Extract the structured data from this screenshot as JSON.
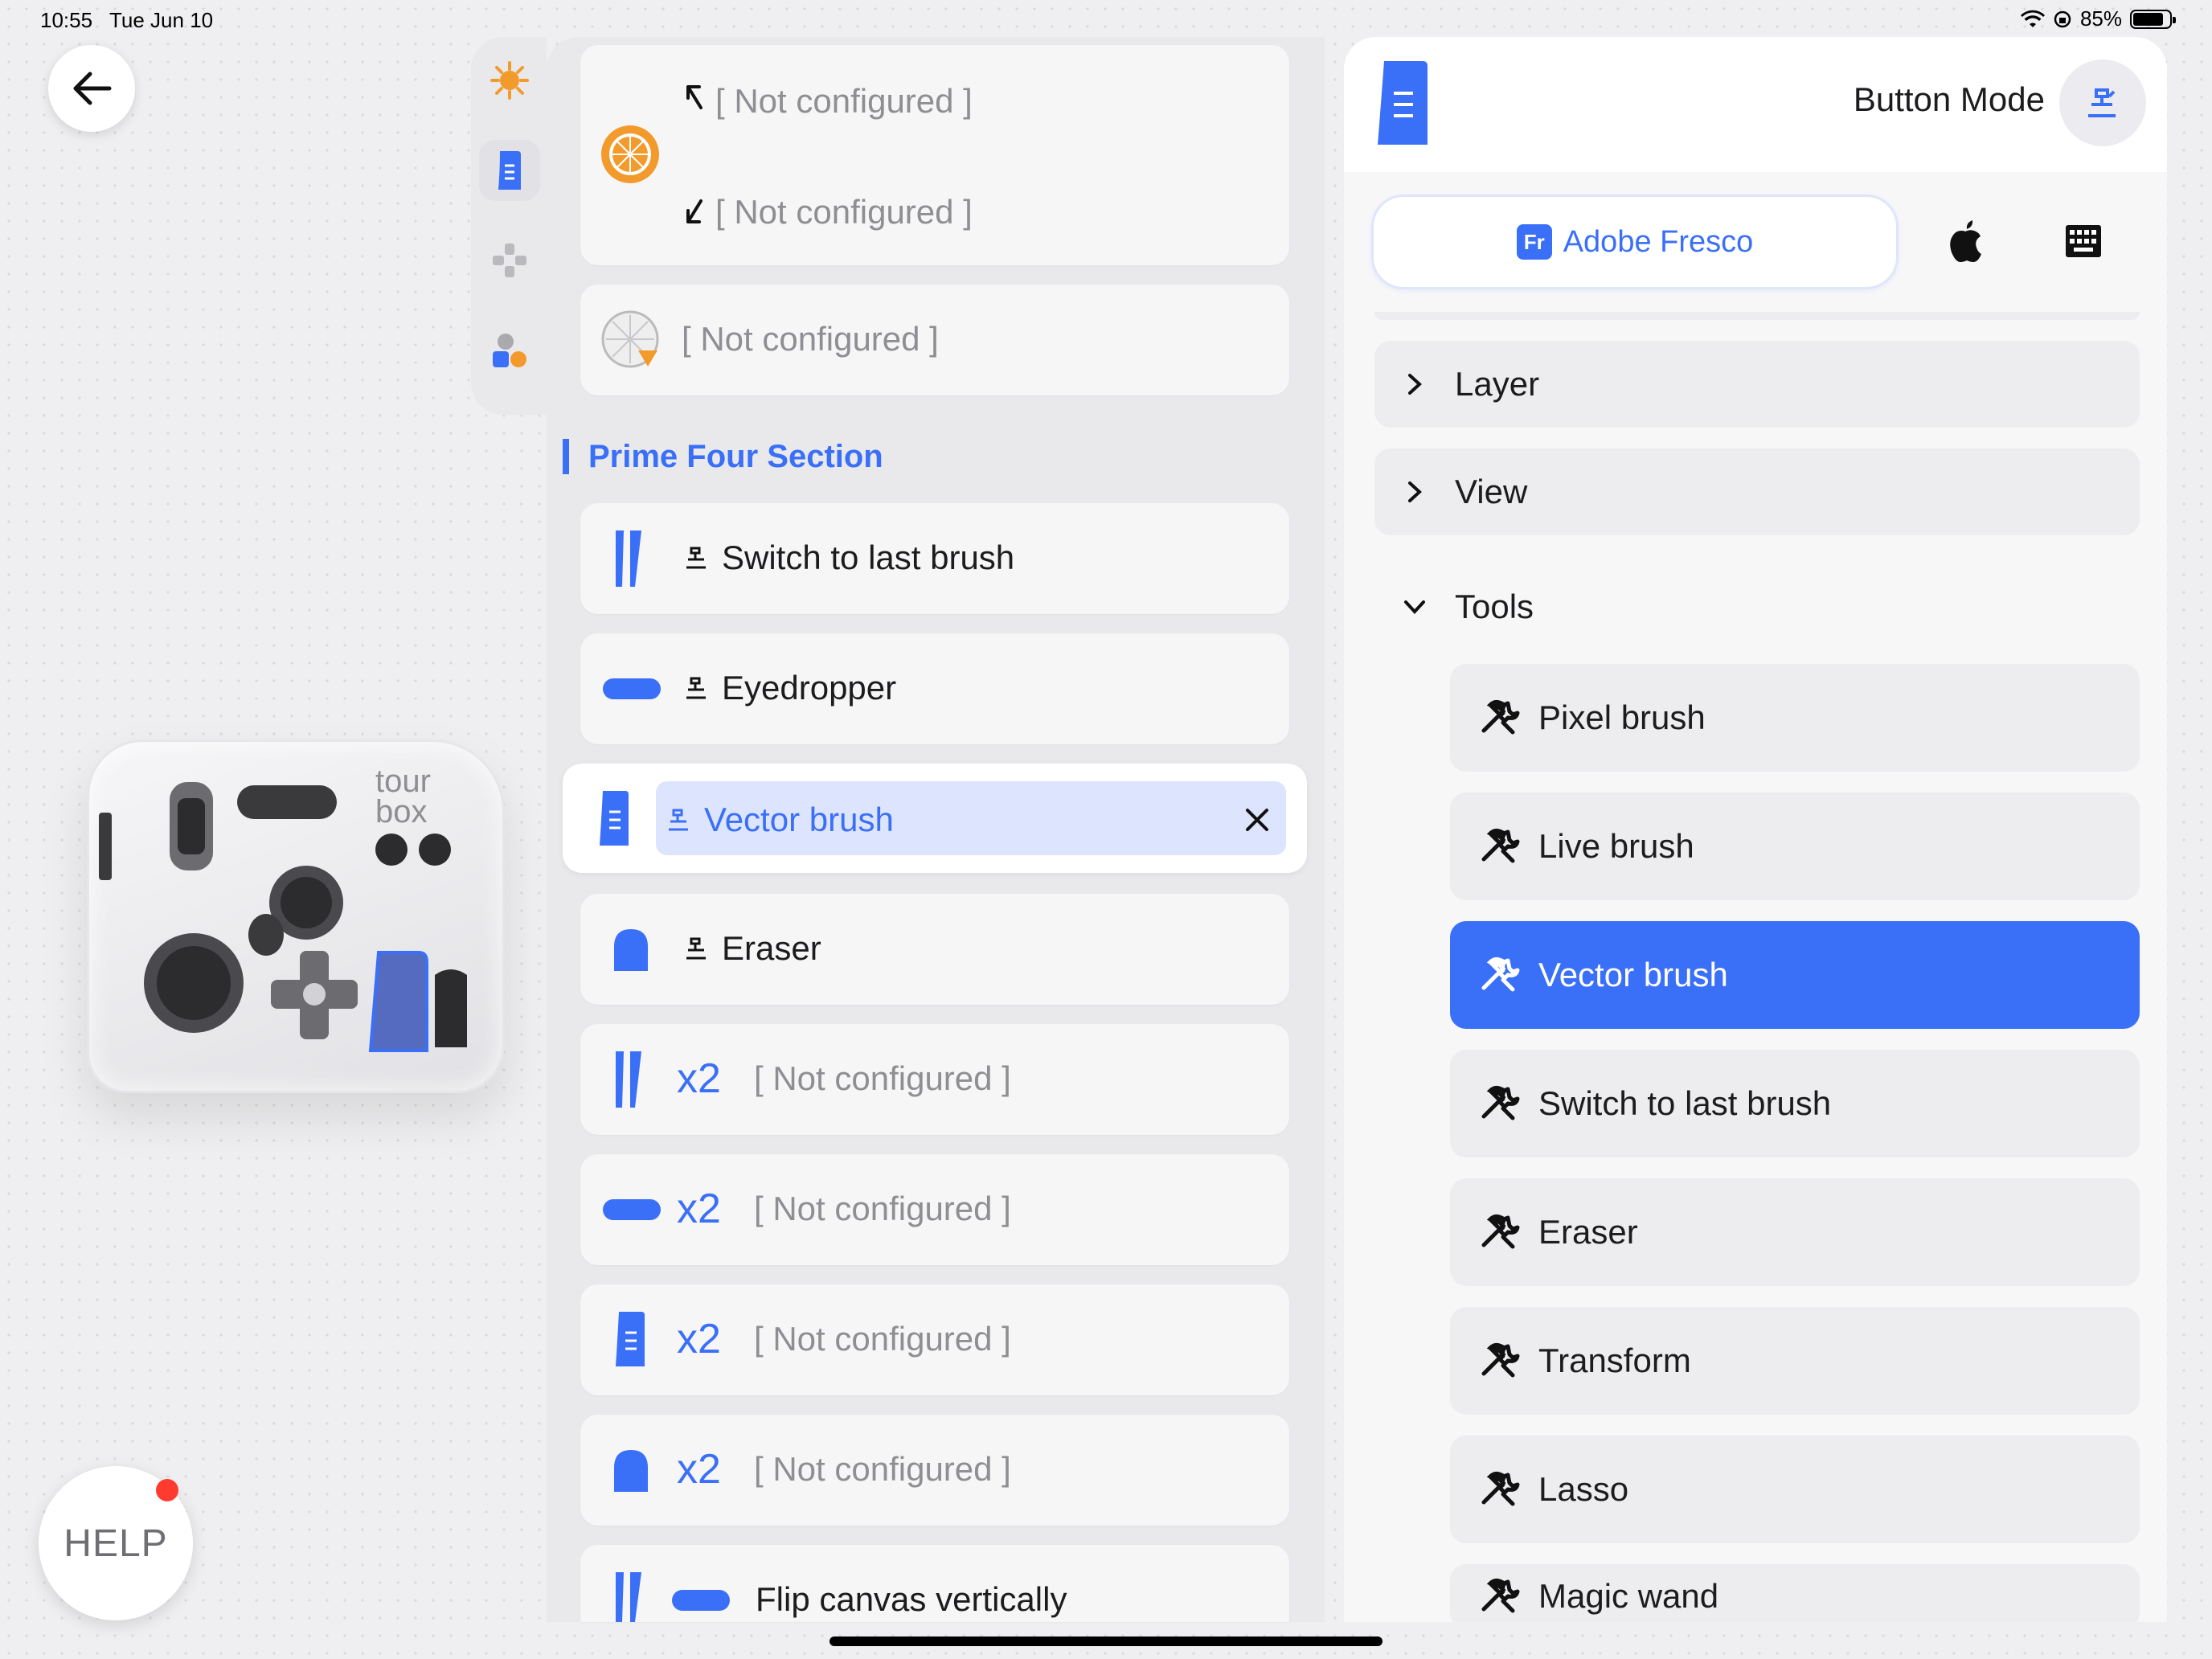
{
  "status": {
    "time": "10:55",
    "date": "Tue Jun 10",
    "battery": "85%"
  },
  "help": {
    "label": "HELP"
  },
  "device": {
    "brand_line1": "tour",
    "brand_line2": "box"
  },
  "buttons": {
    "knob_top": "[ Not configured ]",
    "knob_bottom": "[ Not configured ]",
    "dial": "[ Not configured ]"
  },
  "section": {
    "title": "Prime Four Section"
  },
  "prime": [
    {
      "label": "Switch to last brush"
    },
    {
      "label": "Eyedropper"
    },
    {
      "label": "Vector brush"
    },
    {
      "label": "Eraser"
    },
    {
      "prefix": "x2",
      "label": "[ Not configured ]"
    },
    {
      "prefix": "x2",
      "label": "[ Not configured ]"
    },
    {
      "prefix": "x2",
      "label": "[ Not configured ]"
    },
    {
      "prefix": "x2",
      "label": "[ Not configured ]"
    },
    {
      "label": "Flip canvas vertically"
    }
  ],
  "panel": {
    "mode_label": "Button Mode",
    "app_icon": "Fr",
    "app_name": "Adobe Fresco",
    "categories": [
      "Layer",
      "View"
    ],
    "tools_label": "Tools",
    "tools": [
      "Pixel brush",
      "Live brush",
      "Vector brush",
      "Switch to last brush",
      "Eraser",
      "Transform",
      "Lasso",
      "Magic wand"
    ],
    "active_tool_index": 2
  },
  "colors": {
    "accent": "#3a6ff7",
    "orange": "#f39a2c",
    "selection": "#dde4fd"
  }
}
